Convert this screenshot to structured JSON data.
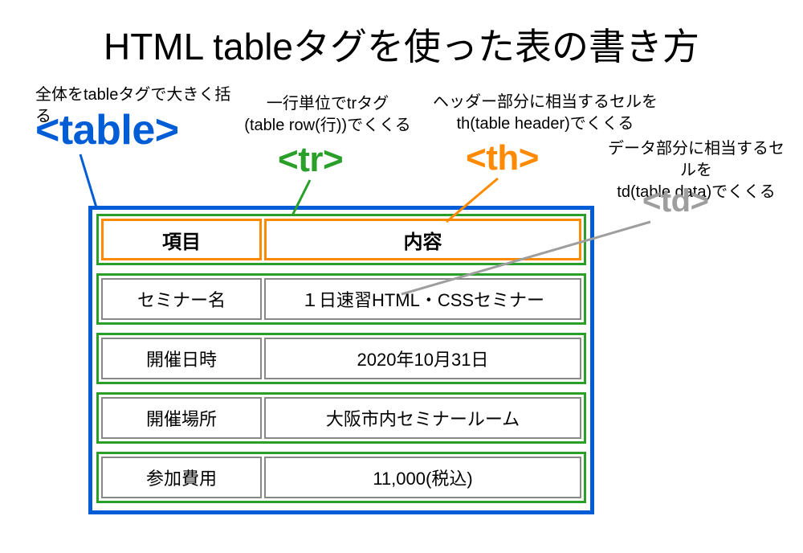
{
  "title": "HTML tableタグを使った表の書き方",
  "callouts": {
    "table": {
      "note": "全体をtableタグで大きく括る",
      "tag": "<table>"
    },
    "tr": {
      "note": "一行単位でtrタグ\n(table row(行))でくくる",
      "tag": "<tr>"
    },
    "th": {
      "note": "ヘッダー部分に相当するセルを\nth(table header)でくくる",
      "tag": "<th>"
    },
    "td": {
      "note": "データ部分に相当するセルを\ntd(table data)でくくる",
      "tag": "<td>"
    }
  },
  "table": {
    "headers": {
      "col1": "項目",
      "col2": "内容"
    },
    "rows": [
      {
        "col1": "セミナー名",
        "col2": "１日速習HTML・CSSセミナー"
      },
      {
        "col1": "開催日時",
        "col2": "2020年10月31日"
      },
      {
        "col1": "開催場所",
        "col2": "大阪市内セミナールーム"
      },
      {
        "col1": "参加費用",
        "col2": "11,000(税込)"
      }
    ]
  },
  "colors": {
    "table_tag": "#005dd6",
    "tr_tag": "#2aa02a",
    "th_tag": "#ff8a00",
    "td_tag": "#9e9e9e"
  }
}
